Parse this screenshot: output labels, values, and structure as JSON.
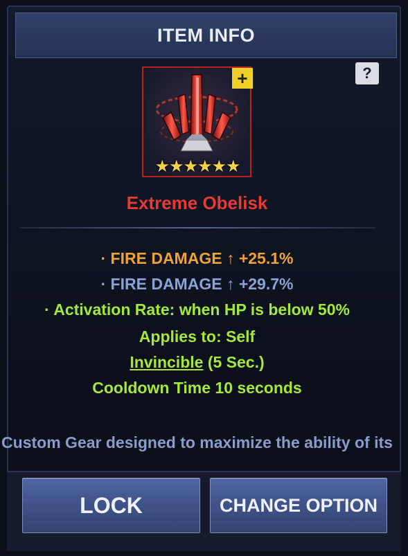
{
  "header": {
    "title": "ITEM INFO"
  },
  "help": {
    "label": "?"
  },
  "item": {
    "name": "Extreme Obelisk",
    "stars": "★★★★★★",
    "plus_label": "+",
    "icon": "obelisk-crystal-icon"
  },
  "stats": {
    "line1": "· FIRE DAMAGE ↑ +25.1%",
    "line2": "· FIRE DAMAGE ↑ +29.7%",
    "line3": "· Activation Rate: when HP is below 50%",
    "line4": "Applies to: Self",
    "invincible": "Invincible",
    "duration": " (5 Sec.)",
    "line6": "Cooldown Time 10 seconds"
  },
  "description": "Custom Gear designed to maximize the ability of its holder.",
  "buttons": {
    "lock": "LOCK",
    "change_option": "CHANGE OPTION"
  },
  "colors": {
    "item_name": "#e83a34",
    "stat_orange": "#f0a23a",
    "stat_blue": "#8aa3d6",
    "stat_green": "#a6e83a",
    "rarity_border": "#c01f1f"
  }
}
